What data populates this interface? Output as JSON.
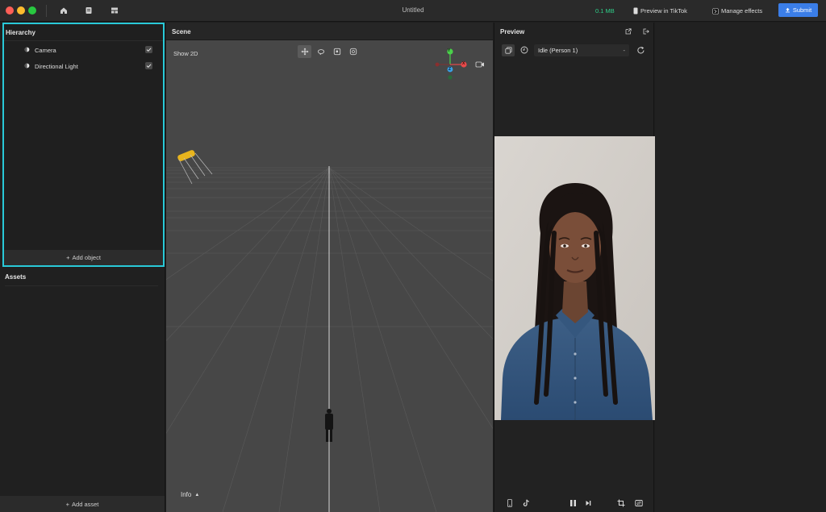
{
  "window": {
    "title": "Untitled",
    "project_size": "0.1 MB"
  },
  "toolbar": {
    "preview_label": "Preview in TikTok",
    "manage_label": "Manage effects",
    "submit_label": "Submit"
  },
  "hierarchy": {
    "title": "Hierarchy",
    "items": [
      {
        "label": "Camera",
        "visible": true
      },
      {
        "label": "Directional Light",
        "visible": true
      }
    ],
    "add_label": "Add object"
  },
  "assets": {
    "title": "Assets",
    "add_label": "Add asset"
  },
  "scene": {
    "title": "Scene",
    "show2d_label": "Show 2D",
    "info_label": "Info",
    "axis_labels": {
      "y": "Y",
      "x": "X",
      "z": "Z"
    }
  },
  "preview": {
    "title": "Preview",
    "animation_value": "Idle (Person 1)"
  },
  "colors": {
    "highlight": "#29c9d8",
    "accent": "#3b7ee8",
    "size_text": "#2fd08a",
    "axis_x": "#e84a4a",
    "axis_y": "#4ad04a",
    "axis_z": "#3aa2e8"
  }
}
